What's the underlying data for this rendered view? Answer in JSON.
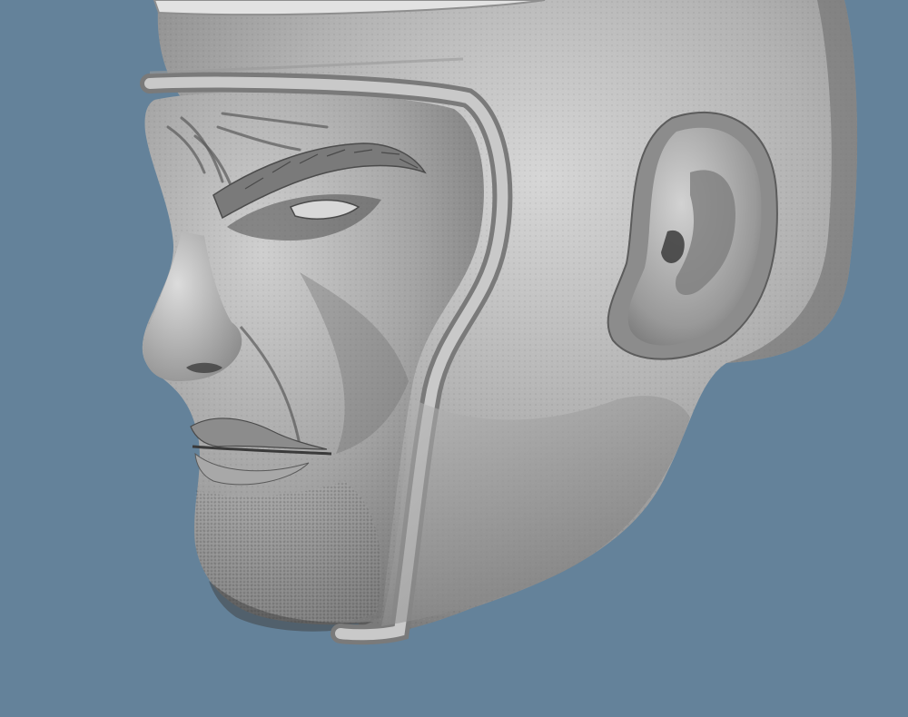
{
  "scene": {
    "subject": "sculpted-head-render",
    "background_color": "#64829a",
    "material_light": "#c9c9c9",
    "material_mid": "#9c9c9c",
    "material_dark": "#5e5e5e",
    "material_shadow": "#3d3d3d"
  }
}
